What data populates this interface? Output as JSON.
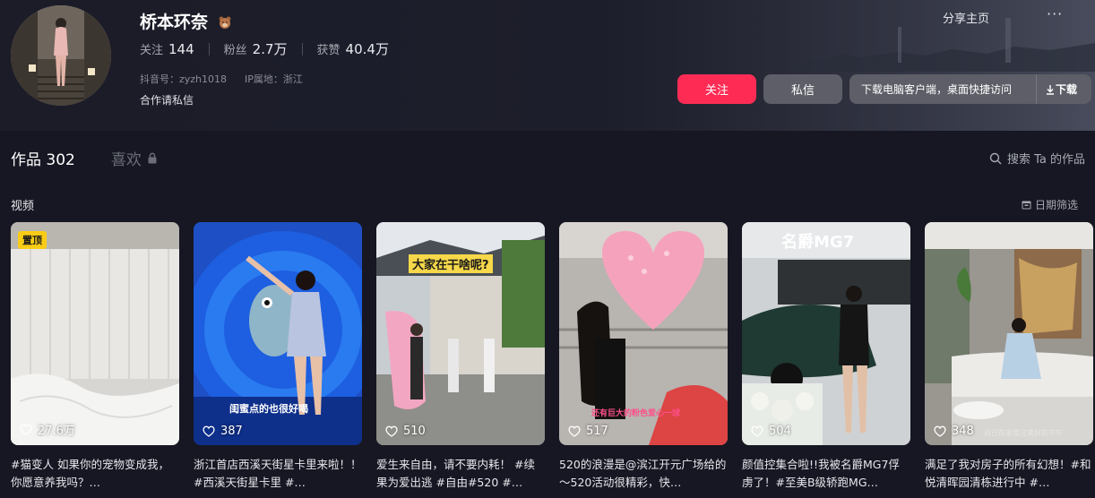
{
  "profile": {
    "name": "桥本环奈",
    "stats": [
      {
        "label": "关注",
        "value": "144"
      },
      {
        "label": "粉丝",
        "value": "2.7万"
      },
      {
        "label": "获赞",
        "value": "40.4万"
      }
    ],
    "douyin_id": "抖音号：zyzh1018",
    "ip_location": "IP属地：浙江",
    "cooperation": "合作请私信"
  },
  "top_actions": {
    "share": "分享主页",
    "more": "···"
  },
  "buttons": {
    "follow": "关注",
    "message": "私信",
    "download_desktop": "下载电脑客户端，桌面快捷访问",
    "download": "下载"
  },
  "tabs": {
    "works_label": "作品",
    "works_count": "302",
    "likes_label": "喜欢"
  },
  "search": {
    "label": "搜索 Ta 的作品"
  },
  "section": {
    "title": "视频",
    "date_filter": "日期筛选"
  },
  "videos": [
    {
      "likes": "27.6万",
      "pinned": "置顶",
      "caption": "#猫变人 如果你的宠物变成我，你愿意养我吗？…"
    },
    {
      "likes": "387",
      "overlay": "闺蜜点的也很好喝",
      "caption": "浙江首店西溪天街星卡里来啦！！ #西溪天街星卡里 #…"
    },
    {
      "likes": "510",
      "overlay": "大家在干啥呢?",
      "caption": "爱生来自由，请不要内耗！ #续果为爱出逃 #自由#520 #…"
    },
    {
      "likes": "517",
      "overlay": "还有巨大的粉色爱心一球",
      "caption": "520的浪漫是@滨江开元广场给的～520活动很精彩，快…"
    },
    {
      "likes": "504",
      "overlay": "名爵MG7",
      "caption": "颜值控集合啦!!我被名爵MG7俘虏了！#至美B级轿跑MG…"
    },
    {
      "likes": "348",
      "overlay": "自己在家度过美好的下午",
      "caption": "满足了我对房子的所有幻想！#和悦清晖园清栋进行中 #…"
    }
  ],
  "colors": {
    "accent": "#fe2c55",
    "background": "#161722",
    "pin": "#facc15"
  }
}
